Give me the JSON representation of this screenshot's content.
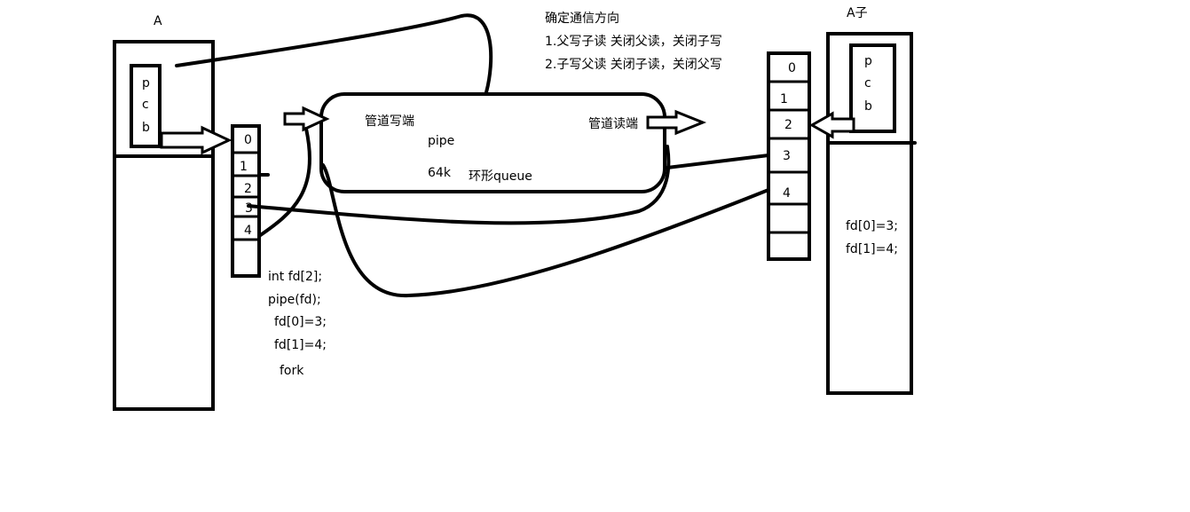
{
  "parent": {
    "label": "A",
    "pcb_letters": [
      "p",
      "c",
      "b"
    ],
    "fd_slots": [
      "0",
      "1",
      "2",
      "3",
      "4",
      ""
    ],
    "code": [
      "int fd[2];",
      "pipe(fd);",
      "fd[0]=3;",
      "fd[1]=4;",
      "fork"
    ]
  },
  "child": {
    "label": "A子",
    "pcb_letters": [
      "p",
      "c",
      "b"
    ],
    "fd_slots": [
      "0",
      "1",
      "2",
      "3",
      "4",
      "",
      ""
    ],
    "code": [
      "fd[0]=3;",
      "fd[1]=4;"
    ]
  },
  "pipe": {
    "write_end": "管道写端",
    "read_end": "管道读端",
    "name": "pipe",
    "size": "64k",
    "buffer": "环形queue"
  },
  "notes": {
    "title": "确定通信方向",
    "lines": [
      "1.父写子读   关闭父读，关闭子写",
      "2.子写父读   关闭子读，关闭父写"
    ]
  }
}
